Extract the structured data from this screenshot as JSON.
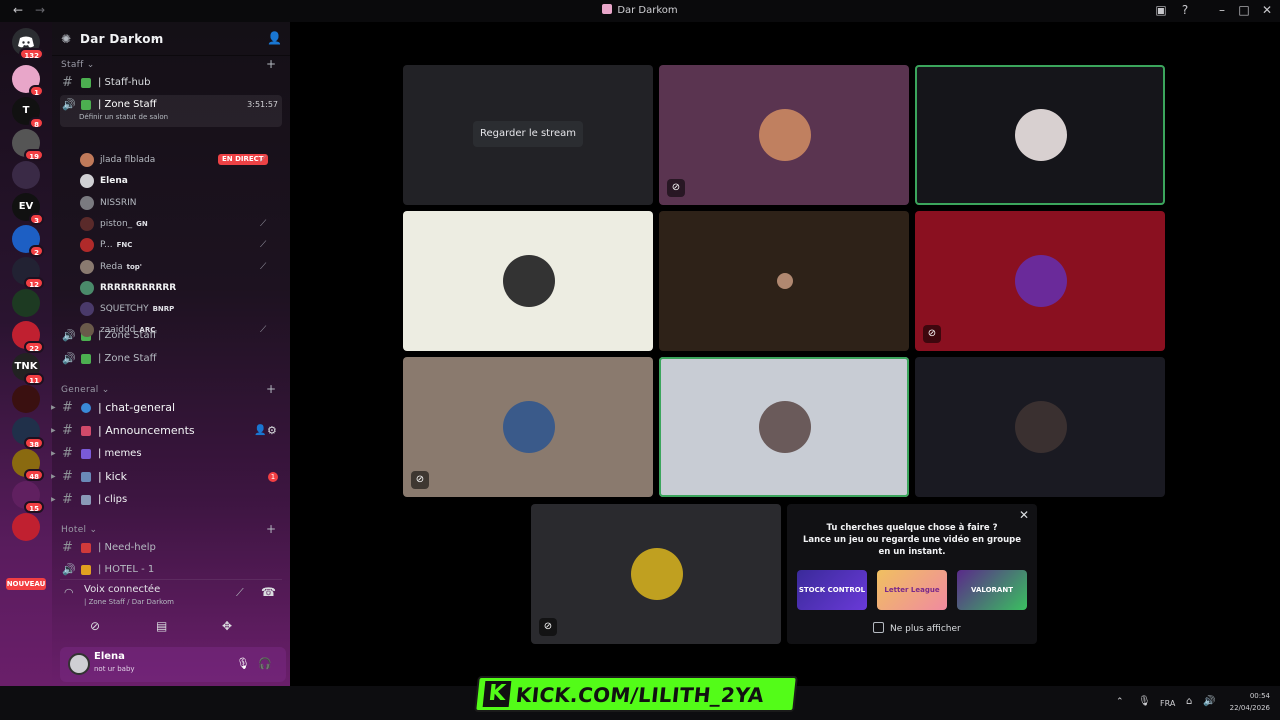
{
  "window": {
    "title": "Dar Darkom"
  },
  "servers": {
    "home_badge": "132",
    "items": [
      {
        "label": "",
        "badge": "1",
        "color": "#e8a6c9"
      },
      {
        "label": "T",
        "badge": "8",
        "color": "#111"
      },
      {
        "label": "",
        "badge": "19",
        "color": "#555"
      },
      {
        "label": "",
        "badge": "",
        "color": "#3a2a46"
      },
      {
        "label": "EV",
        "badge": "3",
        "color": "#111"
      },
      {
        "label": "",
        "badge": "2",
        "color": "#1d5fc4"
      },
      {
        "label": "",
        "badge": "12",
        "color": "#223"
      },
      {
        "label": "",
        "badge": "",
        "color": "#1d3a22"
      },
      {
        "label": "",
        "badge": "22",
        "color": "#c02030"
      },
      {
        "label": "TNK",
        "badge": "11",
        "color": "#222"
      },
      {
        "label": "",
        "badge": "",
        "color": "#3a1010"
      },
      {
        "label": "",
        "badge": "38",
        "color": "#20304a"
      },
      {
        "label": "",
        "badge": "48",
        "color": "#8a6a10"
      },
      {
        "label": "",
        "badge": "15",
        "color": "#602060"
      },
      {
        "label": "",
        "badge": "",
        "color": "#c02030"
      }
    ],
    "new_label": "NOUVEAU"
  },
  "guild": {
    "name": "Dar Darkom"
  },
  "categories": {
    "staff": "Staff",
    "general": "General",
    "hotel": "Hotel"
  },
  "channels": {
    "staff_hub": "| Staff-hub",
    "zone_staff": "| Zone Staff",
    "zone_staff_time": "3:51:57",
    "zone_staff_status": "Définir un statut de salon",
    "zone_staff_2": "| Zone Staff",
    "zone_staff_3": "| Zone Staff",
    "chat_general": "| chat-general",
    "announcements": "| Announcements",
    "memes": "| memes",
    "kick": "| kick",
    "kick_badge": "1",
    "clips": "| clips",
    "need_help": "| Need-help",
    "hotel_1": "| HOTEL - 1"
  },
  "voice_users": [
    {
      "name": "jlada flblada",
      "tag": "",
      "live": "EN DIRECT"
    },
    {
      "name": "Elena",
      "tag": ""
    },
    {
      "name": "NISSRIN",
      "tag": ""
    },
    {
      "name": "piston_",
      "tag": "GN"
    },
    {
      "name": "P...",
      "tag": "FNC"
    },
    {
      "name": "Reda",
      "tag": "top'"
    },
    {
      "name": "RRRRRRRRRRR",
      "tag": ""
    },
    {
      "name": "SQUETCHY",
      "tag": "BNRP"
    },
    {
      "name": "zaaiddd",
      "tag": "ARC"
    }
  ],
  "voice_panel": {
    "status": "Voix connectée",
    "location": "| Zone Staff / Dar Darkom"
  },
  "user_panel": {
    "name": "Elena",
    "status": "not ur baby"
  },
  "stage": {
    "watch_stream": "Regarder le stream",
    "tiles": [
      {
        "bg": "#222226",
        "avatar": "",
        "muted": false,
        "speaking": false
      },
      {
        "bg": "#5a3450",
        "avatar": "#c08060",
        "muted": true,
        "speaking": false
      },
      {
        "bg": "#15151a",
        "avatar": "#d8d0d0",
        "muted": false,
        "speaking": true
      },
      {
        "bg": "#ededE2",
        "avatar": "#333",
        "muted": false,
        "speaking": false
      },
      {
        "bg": "#2e2218",
        "avatar": "#b08870",
        "muted": false,
        "speaking": false
      },
      {
        "bg": "#8a1020",
        "avatar": "#6a2a9a",
        "muted": true,
        "speaking": false
      },
      {
        "bg": "#8a7a6e",
        "avatar": "#3a5a8a",
        "muted": true,
        "speaking": false
      },
      {
        "bg": "#c8ccd4",
        "avatar": "#6a5a5a",
        "muted": false,
        "speaking": true
      },
      {
        "bg": "#1a1a22",
        "avatar": "#3a3030",
        "muted": false,
        "speaking": false
      },
      {
        "bg": "#2a2a2e",
        "avatar": "#c0a020",
        "muted": true,
        "speaking": false
      }
    ]
  },
  "promo": {
    "line1": "Tu cherches quelque chose à faire ?",
    "line2": "Lance un jeu ou regarde une vidéo en groupe en un instant.",
    "activities": [
      "STOCK CONTROL",
      "Letter League",
      "VALORANT"
    ],
    "dont_show": "Ne plus afficher"
  },
  "overlay": {
    "kick_url": "KICK.COM/LILITH_2YA"
  },
  "taskbar": {
    "lang": "FRA",
    "time": "00:54",
    "date": "22/04/2026"
  }
}
